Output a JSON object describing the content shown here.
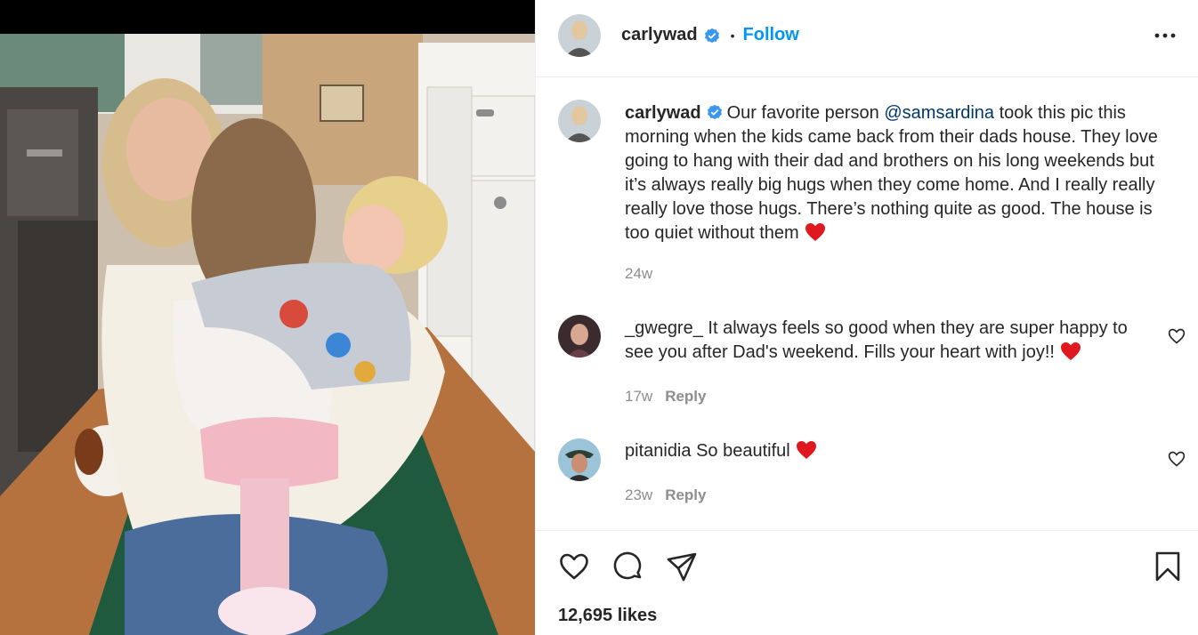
{
  "post": {
    "username": "carlywad",
    "follow_label": "Follow",
    "dot": "•"
  },
  "caption": {
    "username": "carlywad",
    "text_before": "Our favorite person ",
    "mention": "@samsardina",
    "text_after": " took this pic this morning when the kids came back from their dads house. They love going to hang with their dad and brothers on his long weekends but it’s always really big hugs when they come home. And I really really really love those hugs. There’s nothing quite as good. The house is too quiet without them",
    "time": "24w"
  },
  "comments": [
    {
      "username": "_gwegre_",
      "text": "It always feels so good when they are super happy to see you after Dad's weekend. Fills your heart with joy!!",
      "time": "17w",
      "reply_label": "Reply"
    },
    {
      "username": "pitanidia",
      "text": "So beautiful",
      "time": "23w",
      "reply_label": "Reply"
    }
  ],
  "likes_text": "12,695 likes",
  "icons": [
    "verified-badge-icon",
    "more-options-icon",
    "heart-icon",
    "comment-icon",
    "share-icon",
    "bookmark-icon"
  ],
  "colors": {
    "accent": "#0095f6",
    "mention": "#00376b",
    "muted": "#8e8e8e",
    "heart_emoji": "#e0191e"
  }
}
